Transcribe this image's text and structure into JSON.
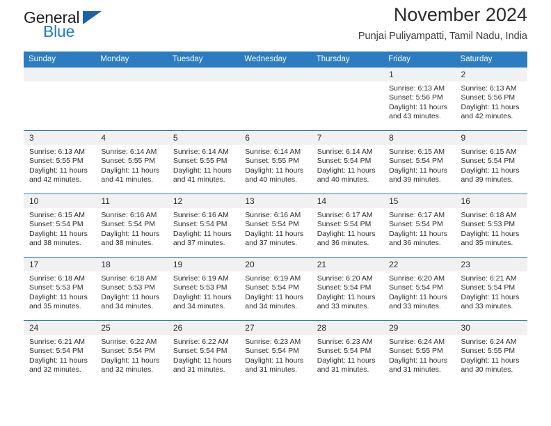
{
  "brand": {
    "name_part1": "General",
    "name_part2": "Blue",
    "flag_icon": "triangle-flag-icon"
  },
  "header": {
    "month_title": "November 2024",
    "location": "Punjai Puliyampatti, Tamil Nadu, India"
  },
  "colors": {
    "header_blue": "#2b7cc0",
    "brand_blue": "#1d7cc4",
    "daynum_bg": "#f1f1f1",
    "text": "#2c2c2c"
  },
  "calendar": {
    "weekday_headers": [
      "Sunday",
      "Monday",
      "Tuesday",
      "Wednesday",
      "Thursday",
      "Friday",
      "Saturday"
    ],
    "labels": {
      "sunrise": "Sunrise:",
      "sunset": "Sunset:",
      "daylight": "Daylight:"
    },
    "weeks": [
      [
        {
          "day": "",
          "sunrise": "",
          "sunset": "",
          "daylight_a": "",
          "daylight_b": "",
          "empty": true
        },
        {
          "day": "",
          "sunrise": "",
          "sunset": "",
          "daylight_a": "",
          "daylight_b": "",
          "empty": true
        },
        {
          "day": "",
          "sunrise": "",
          "sunset": "",
          "daylight_a": "",
          "daylight_b": "",
          "empty": true
        },
        {
          "day": "",
          "sunrise": "",
          "sunset": "",
          "daylight_a": "",
          "daylight_b": "",
          "empty": true
        },
        {
          "day": "",
          "sunrise": "",
          "sunset": "",
          "daylight_a": "",
          "daylight_b": "",
          "empty": true
        },
        {
          "day": "1",
          "sunrise": "Sunrise: 6:13 AM",
          "sunset": "Sunset: 5:56 PM",
          "daylight_a": "Daylight: 11 hours",
          "daylight_b": "and 43 minutes.",
          "empty": false
        },
        {
          "day": "2",
          "sunrise": "Sunrise: 6:13 AM",
          "sunset": "Sunset: 5:56 PM",
          "daylight_a": "Daylight: 11 hours",
          "daylight_b": "and 42 minutes.",
          "empty": false
        }
      ],
      [
        {
          "day": "3",
          "sunrise": "Sunrise: 6:13 AM",
          "sunset": "Sunset: 5:55 PM",
          "daylight_a": "Daylight: 11 hours",
          "daylight_b": "and 42 minutes.",
          "empty": false
        },
        {
          "day": "4",
          "sunrise": "Sunrise: 6:14 AM",
          "sunset": "Sunset: 5:55 PM",
          "daylight_a": "Daylight: 11 hours",
          "daylight_b": "and 41 minutes.",
          "empty": false
        },
        {
          "day": "5",
          "sunrise": "Sunrise: 6:14 AM",
          "sunset": "Sunset: 5:55 PM",
          "daylight_a": "Daylight: 11 hours",
          "daylight_b": "and 41 minutes.",
          "empty": false
        },
        {
          "day": "6",
          "sunrise": "Sunrise: 6:14 AM",
          "sunset": "Sunset: 5:55 PM",
          "daylight_a": "Daylight: 11 hours",
          "daylight_b": "and 40 minutes.",
          "empty": false
        },
        {
          "day": "7",
          "sunrise": "Sunrise: 6:14 AM",
          "sunset": "Sunset: 5:54 PM",
          "daylight_a": "Daylight: 11 hours",
          "daylight_b": "and 40 minutes.",
          "empty": false
        },
        {
          "day": "8",
          "sunrise": "Sunrise: 6:15 AM",
          "sunset": "Sunset: 5:54 PM",
          "daylight_a": "Daylight: 11 hours",
          "daylight_b": "and 39 minutes.",
          "empty": false
        },
        {
          "day": "9",
          "sunrise": "Sunrise: 6:15 AM",
          "sunset": "Sunset: 5:54 PM",
          "daylight_a": "Daylight: 11 hours",
          "daylight_b": "and 39 minutes.",
          "empty": false
        }
      ],
      [
        {
          "day": "10",
          "sunrise": "Sunrise: 6:15 AM",
          "sunset": "Sunset: 5:54 PM",
          "daylight_a": "Daylight: 11 hours",
          "daylight_b": "and 38 minutes.",
          "empty": false
        },
        {
          "day": "11",
          "sunrise": "Sunrise: 6:16 AM",
          "sunset": "Sunset: 5:54 PM",
          "daylight_a": "Daylight: 11 hours",
          "daylight_b": "and 38 minutes.",
          "empty": false
        },
        {
          "day": "12",
          "sunrise": "Sunrise: 6:16 AM",
          "sunset": "Sunset: 5:54 PM",
          "daylight_a": "Daylight: 11 hours",
          "daylight_b": "and 37 minutes.",
          "empty": false
        },
        {
          "day": "13",
          "sunrise": "Sunrise: 6:16 AM",
          "sunset": "Sunset: 5:54 PM",
          "daylight_a": "Daylight: 11 hours",
          "daylight_b": "and 37 minutes.",
          "empty": false
        },
        {
          "day": "14",
          "sunrise": "Sunrise: 6:17 AM",
          "sunset": "Sunset: 5:54 PM",
          "daylight_a": "Daylight: 11 hours",
          "daylight_b": "and 36 minutes.",
          "empty": false
        },
        {
          "day": "15",
          "sunrise": "Sunrise: 6:17 AM",
          "sunset": "Sunset: 5:54 PM",
          "daylight_a": "Daylight: 11 hours",
          "daylight_b": "and 36 minutes.",
          "empty": false
        },
        {
          "day": "16",
          "sunrise": "Sunrise: 6:18 AM",
          "sunset": "Sunset: 5:53 PM",
          "daylight_a": "Daylight: 11 hours",
          "daylight_b": "and 35 minutes.",
          "empty": false
        }
      ],
      [
        {
          "day": "17",
          "sunrise": "Sunrise: 6:18 AM",
          "sunset": "Sunset: 5:53 PM",
          "daylight_a": "Daylight: 11 hours",
          "daylight_b": "and 35 minutes.",
          "empty": false
        },
        {
          "day": "18",
          "sunrise": "Sunrise: 6:18 AM",
          "sunset": "Sunset: 5:53 PM",
          "daylight_a": "Daylight: 11 hours",
          "daylight_b": "and 34 minutes.",
          "empty": false
        },
        {
          "day": "19",
          "sunrise": "Sunrise: 6:19 AM",
          "sunset": "Sunset: 5:53 PM",
          "daylight_a": "Daylight: 11 hours",
          "daylight_b": "and 34 minutes.",
          "empty": false
        },
        {
          "day": "20",
          "sunrise": "Sunrise: 6:19 AM",
          "sunset": "Sunset: 5:54 PM",
          "daylight_a": "Daylight: 11 hours",
          "daylight_b": "and 34 minutes.",
          "empty": false
        },
        {
          "day": "21",
          "sunrise": "Sunrise: 6:20 AM",
          "sunset": "Sunset: 5:54 PM",
          "daylight_a": "Daylight: 11 hours",
          "daylight_b": "and 33 minutes.",
          "empty": false
        },
        {
          "day": "22",
          "sunrise": "Sunrise: 6:20 AM",
          "sunset": "Sunset: 5:54 PM",
          "daylight_a": "Daylight: 11 hours",
          "daylight_b": "and 33 minutes.",
          "empty": false
        },
        {
          "day": "23",
          "sunrise": "Sunrise: 6:21 AM",
          "sunset": "Sunset: 5:54 PM",
          "daylight_a": "Daylight: 11 hours",
          "daylight_b": "and 33 minutes.",
          "empty": false
        }
      ],
      [
        {
          "day": "24",
          "sunrise": "Sunrise: 6:21 AM",
          "sunset": "Sunset: 5:54 PM",
          "daylight_a": "Daylight: 11 hours",
          "daylight_b": "and 32 minutes.",
          "empty": false
        },
        {
          "day": "25",
          "sunrise": "Sunrise: 6:22 AM",
          "sunset": "Sunset: 5:54 PM",
          "daylight_a": "Daylight: 11 hours",
          "daylight_b": "and 32 minutes.",
          "empty": false
        },
        {
          "day": "26",
          "sunrise": "Sunrise: 6:22 AM",
          "sunset": "Sunset: 5:54 PM",
          "daylight_a": "Daylight: 11 hours",
          "daylight_b": "and 31 minutes.",
          "empty": false
        },
        {
          "day": "27",
          "sunrise": "Sunrise: 6:23 AM",
          "sunset": "Sunset: 5:54 PM",
          "daylight_a": "Daylight: 11 hours",
          "daylight_b": "and 31 minutes.",
          "empty": false
        },
        {
          "day": "28",
          "sunrise": "Sunrise: 6:23 AM",
          "sunset": "Sunset: 5:54 PM",
          "daylight_a": "Daylight: 11 hours",
          "daylight_b": "and 31 minutes.",
          "empty": false
        },
        {
          "day": "29",
          "sunrise": "Sunrise: 6:24 AM",
          "sunset": "Sunset: 5:55 PM",
          "daylight_a": "Daylight: 11 hours",
          "daylight_b": "and 31 minutes.",
          "empty": false
        },
        {
          "day": "30",
          "sunrise": "Sunrise: 6:24 AM",
          "sunset": "Sunset: 5:55 PM",
          "daylight_a": "Daylight: 11 hours",
          "daylight_b": "and 30 minutes.",
          "empty": false
        }
      ]
    ]
  }
}
